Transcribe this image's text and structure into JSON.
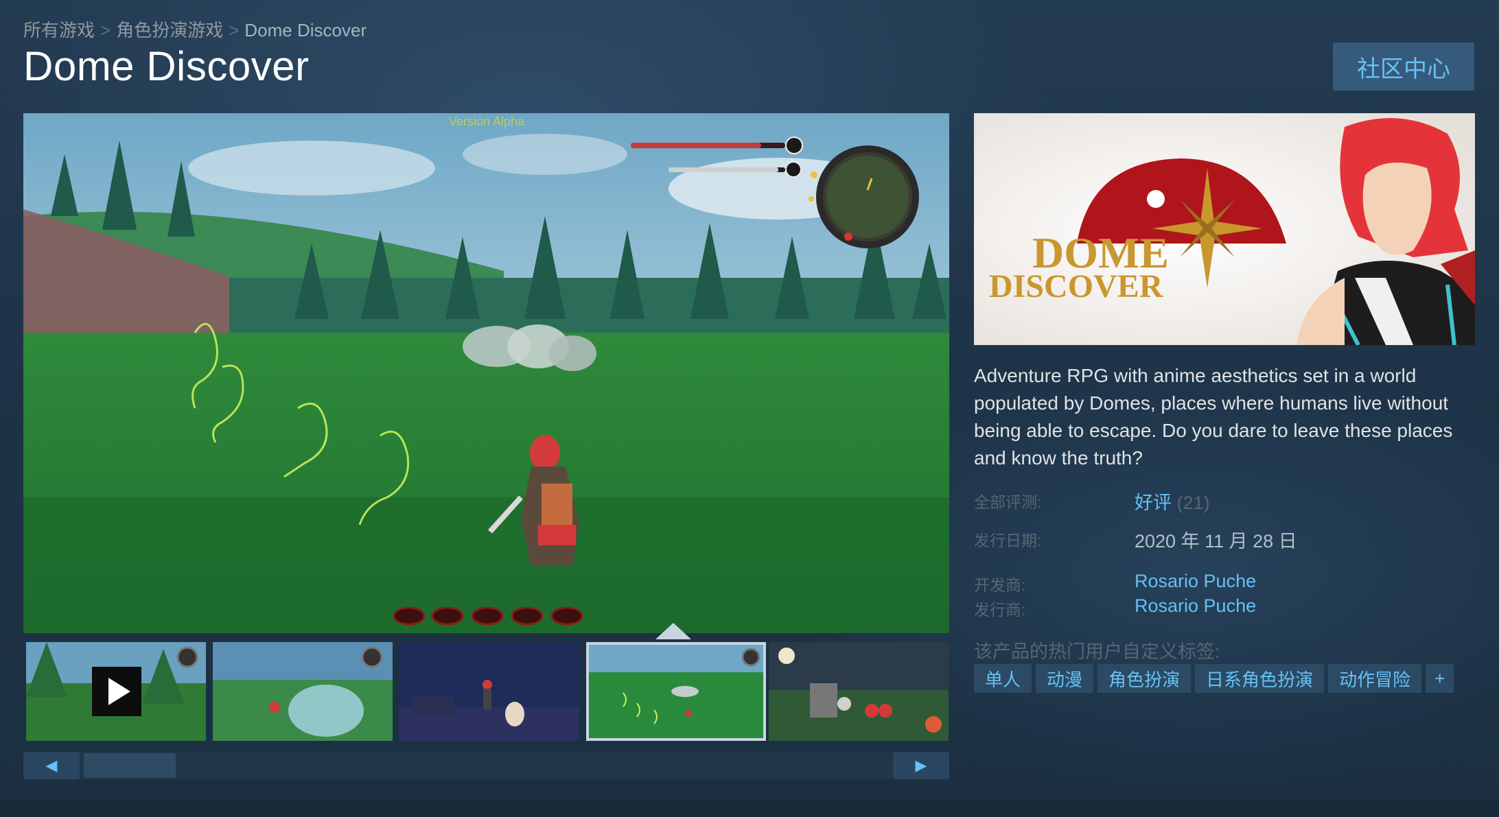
{
  "breadcrumb": {
    "items": [
      "所有游戏",
      "角色扮演游戏",
      "Dome Discover"
    ],
    "separator": ">"
  },
  "title": "Dome Discover",
  "community_button": "社区中心",
  "viewer": {
    "overlay_text": "Version Alpha",
    "thumbnails": [
      {
        "name": "video",
        "has_play": true
      },
      {
        "name": "shot-1"
      },
      {
        "name": "shot-2"
      },
      {
        "name": "shot-3",
        "selected": true
      },
      {
        "name": "shot-4"
      }
    ]
  },
  "scrollbar": {
    "left_arrow": "◀",
    "right_arrow": "▶"
  },
  "capsule": {
    "logo_line1": "DOME",
    "logo_line2": "DISCOVER"
  },
  "description": "Adventure RPG with anime aesthetics set in a world populated by Domes, places where humans live without being able to escape. Do you dare to leave these places and know the truth?",
  "info": {
    "reviews_label": "全部评测:",
    "reviews_value": "好评",
    "reviews_count": "(21)",
    "release_label": "发行日期:",
    "release_value": "2020 年 11 月 28 日",
    "developer_label": "开发商:",
    "developer_value": "Rosario Puche",
    "publisher_label": "发行商:",
    "publisher_value": "Rosario Puche"
  },
  "tags": {
    "heading": "该产品的热门用户自定义标签:",
    "items": [
      "单人",
      "动漫",
      "角色扮演",
      "日系角色扮演",
      "动作冒险"
    ],
    "plus": "+"
  },
  "colors": {
    "link": "#66c0f4",
    "label": "#556772",
    "title": "#ffffff",
    "tag_bg": "#2c4a63",
    "button_bg": "#355a7c"
  }
}
